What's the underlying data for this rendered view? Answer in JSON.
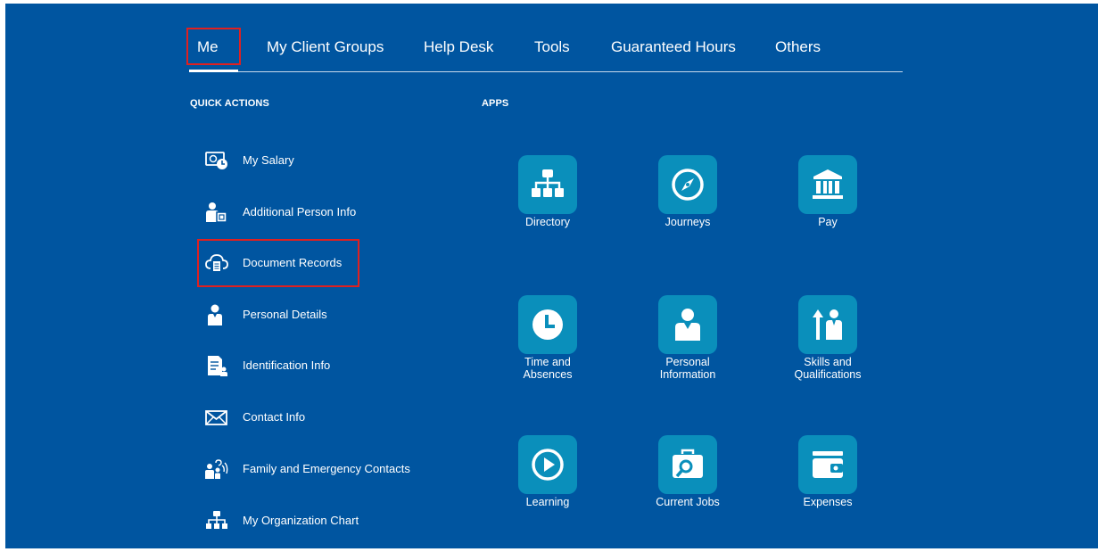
{
  "tabs": [
    {
      "label": "Me"
    },
    {
      "label": "My Client Groups"
    },
    {
      "label": "Help Desk"
    },
    {
      "label": "Tools"
    },
    {
      "label": "Guaranteed Hours"
    },
    {
      "label": "Others"
    }
  ],
  "sections": {
    "quick_actions": "QUICK ACTIONS",
    "apps": "APPS"
  },
  "quick_actions": [
    {
      "label": "My Salary",
      "icon": "salary-icon"
    },
    {
      "label": "Additional Person Info",
      "icon": "person-info-icon"
    },
    {
      "label": "Document Records",
      "icon": "cloud-document-icon"
    },
    {
      "label": "Personal Details",
      "icon": "person-icon"
    },
    {
      "label": "Identification Info",
      "icon": "id-document-icon"
    },
    {
      "label": "Contact Info",
      "icon": "envelope-icon"
    },
    {
      "label": "Family and Emergency Contacts",
      "icon": "family-icon"
    },
    {
      "label": "My Organization Chart",
      "icon": "org-chart-icon"
    }
  ],
  "apps": [
    {
      "label": "Directory",
      "icon": "org-chart-icon"
    },
    {
      "label": "Journeys",
      "icon": "compass-icon"
    },
    {
      "label": "Pay",
      "icon": "bank-icon"
    },
    {
      "label": "Time and Absences",
      "icon": "clock-icon"
    },
    {
      "label": "Personal Information",
      "icon": "person-icon"
    },
    {
      "label": "Skills and Qualifications",
      "icon": "skills-icon"
    },
    {
      "label": "Learning",
      "icon": "play-icon"
    },
    {
      "label": "Current Jobs",
      "icon": "job-search-icon"
    },
    {
      "label": "Expenses",
      "icon": "wallet-icon"
    }
  ],
  "colors": {
    "background": "#0055a0",
    "tile": "#0a8fbb",
    "highlight": "#e02020"
  }
}
